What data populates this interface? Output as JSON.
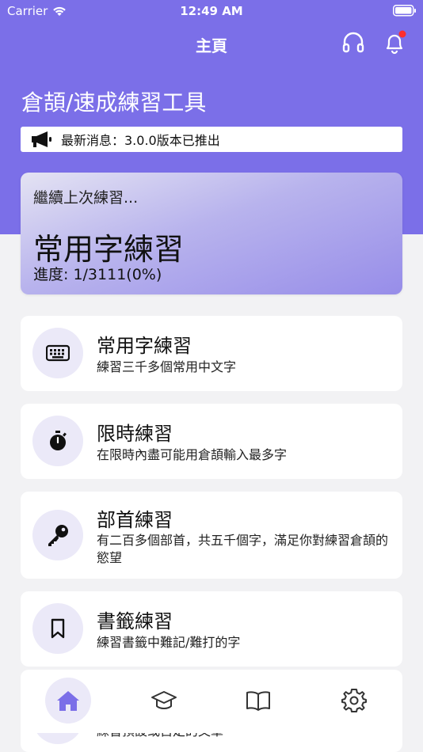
{
  "status_bar": {
    "carrier": "Carrier",
    "time": "12:49 AM"
  },
  "navbar": {
    "title": "主頁"
  },
  "header": {
    "app_title": "倉頡/速成練習工具",
    "news": "最新消息：3.0.0版本已推出"
  },
  "resume": {
    "caption": "繼續上次練習...",
    "title": "常用字練習",
    "progress": "進度: 1/3111(0%)"
  },
  "menu": [
    {
      "title": "常用字練習",
      "desc": "練習三千多個常用中文字",
      "icon": "keyboard-icon"
    },
    {
      "title": "限時練習",
      "desc": "在限時內盡可能用倉頡輸入最多字",
      "icon": "stopwatch-icon"
    },
    {
      "title": "部首練習",
      "desc": "有二百多個部首，共五千個字，滿足你對練習倉頡的慾望",
      "icon": "key-icon"
    },
    {
      "title": "書籤練習",
      "desc": "練習書籤中難記/難打的字",
      "icon": "bookmark-icon"
    }
  ],
  "partial_item": {
    "desc": "練習預設或自定的文章"
  },
  "tabbar": {
    "tabs": [
      {
        "icon": "home-icon",
        "active": true
      },
      {
        "icon": "graduation-cap-icon",
        "active": false
      },
      {
        "icon": "book-icon",
        "active": false
      },
      {
        "icon": "gear-icon",
        "active": false
      }
    ]
  },
  "colors": {
    "primary": "#7b6fe8",
    "tint": "#ebe9f8",
    "badge": "#ff2d2d",
    "background": "#f2f2f4"
  }
}
